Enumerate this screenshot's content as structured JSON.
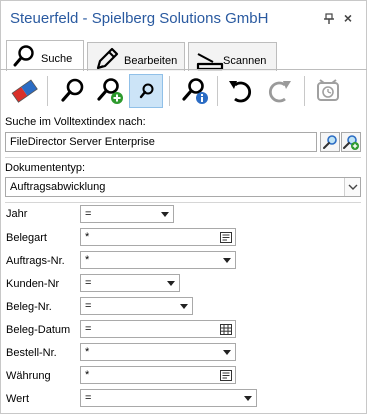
{
  "window": {
    "title": "Steuerfeld - Spielberg Solutions GmbH",
    "pin_icon": "pin-icon",
    "close_label": "×"
  },
  "tabs": [
    {
      "label": "Suche",
      "icon": "magnifier-icon",
      "active": true
    },
    {
      "label": "Bearbeiten",
      "icon": "pencil-icon",
      "active": false
    },
    {
      "label": "Scannen",
      "icon": "scanner-icon",
      "active": false
    }
  ],
  "toolbar": [
    {
      "name": "eraser-icon"
    },
    {
      "name": "search-icon"
    },
    {
      "name": "search-add-icon"
    },
    {
      "name": "search-small-icon",
      "active": true
    },
    {
      "name": "search-info-icon"
    },
    {
      "name": "undo-icon"
    },
    {
      "name": "redo-icon"
    },
    {
      "name": "alarm-icon"
    }
  ],
  "fulltext": {
    "label": "Suche im Volltextindex nach:",
    "value": "FileDirector Server Enterprise"
  },
  "doctype": {
    "label": "Dokumententyp:",
    "value": "Auftragsabwicklung"
  },
  "fields": [
    {
      "label": "Jahr",
      "op": "=",
      "kind": "select"
    },
    {
      "label": "Belegart",
      "op": "*",
      "kind": "list"
    },
    {
      "label": "Auftrags-Nr.",
      "op": "*",
      "kind": "select"
    },
    {
      "label": "Kunden-Nr",
      "op": "=",
      "kind": "select"
    },
    {
      "label": "Beleg-Nr.",
      "op": "=",
      "kind": "select"
    },
    {
      "label": "Beleg-Datum",
      "op": "=",
      "kind": "date"
    },
    {
      "label": "Bestell-Nr.",
      "op": "*",
      "kind": "select"
    },
    {
      "label": "Währung",
      "op": "*",
      "kind": "list"
    },
    {
      "label": "Wert",
      "op": "=",
      "kind": "select"
    }
  ],
  "colors": {
    "title": "#2a5aa0",
    "active_button": "#cce4f7",
    "accent_green": "#2e9a2e",
    "accent_red": "#d9302a",
    "accent_blue": "#2b6cc4"
  }
}
